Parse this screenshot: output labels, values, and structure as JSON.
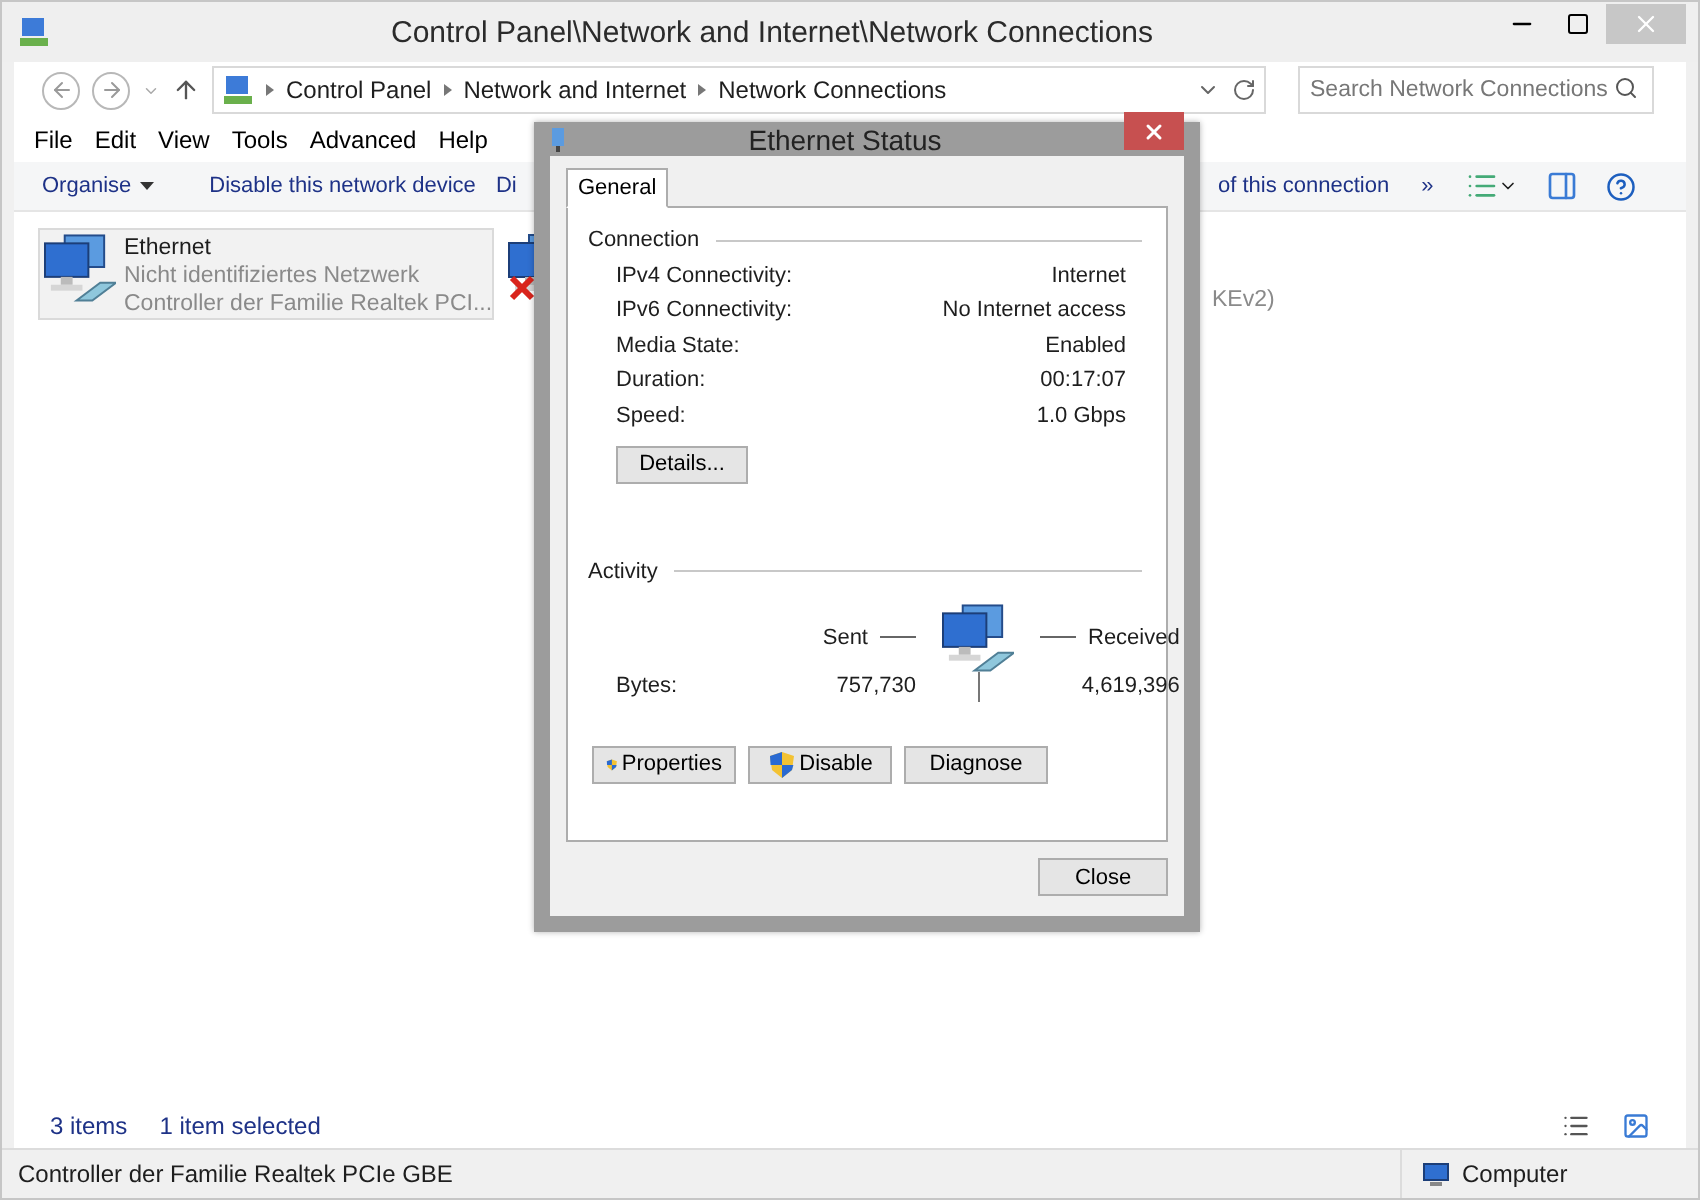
{
  "window": {
    "title": "Control Panel\\Network and Internet\\Network Connections"
  },
  "address": {
    "crumbs": [
      "Control Panel",
      "Network and Internet",
      "Network Connections"
    ]
  },
  "search": {
    "placeholder": "Search Network Connections"
  },
  "menu": [
    "File",
    "Edit",
    "View",
    "Tools",
    "Advanced",
    "Help"
  ],
  "toolbar": {
    "left": [
      {
        "label": "Organise",
        "dropdown": true
      },
      {
        "label": "Disable this network device",
        "dropdown": false
      },
      {
        "label": "Di",
        "dropdown": false
      }
    ],
    "right": [
      {
        "label": "of this connection"
      },
      {
        "label": "»"
      }
    ]
  },
  "connections": [
    {
      "lines": [
        "Ethernet",
        "Nicht identifiziertes Netzwerk",
        "Controller der Familie Realtek PCI..."
      ],
      "selected": true,
      "disconnected": false
    },
    {
      "selected": false,
      "disconnected": true
    },
    {
      "lines": [
        "KEv2)"
      ],
      "selected": false,
      "kind": "text-only"
    }
  ],
  "status_bar": {
    "count": "3 items",
    "selection": "1 item selected"
  },
  "details_bar": {
    "description": "Controller der Familie Realtek PCIe GBE",
    "location": "Computer"
  },
  "dialog": {
    "title": "Ethernet Status",
    "tabs": [
      {
        "label": "General",
        "selected": true
      }
    ],
    "connection": {
      "heading": "Connection",
      "rows": [
        {
          "label": "IPv4 Connectivity:",
          "value": "Internet"
        },
        {
          "label": "IPv6 Connectivity:",
          "value": "No Internet access"
        },
        {
          "label": "Media State:",
          "value": "Enabled"
        },
        {
          "label": "Duration:",
          "value": "00:17:07"
        },
        {
          "label": "Speed:",
          "value": "1.0 Gbps"
        }
      ],
      "details_button": "Details..."
    },
    "activity": {
      "heading": "Activity",
      "sent_label": "Sent",
      "received_label": "Received",
      "bytes_label": "Bytes:",
      "sent": "757,730",
      "received": "4,619,396"
    },
    "buttons": [
      {
        "label": "Properties",
        "shield": true
      },
      {
        "label": "Disable",
        "shield": true
      },
      {
        "label": "Diagnose",
        "shield": false
      }
    ],
    "close": "Close"
  }
}
